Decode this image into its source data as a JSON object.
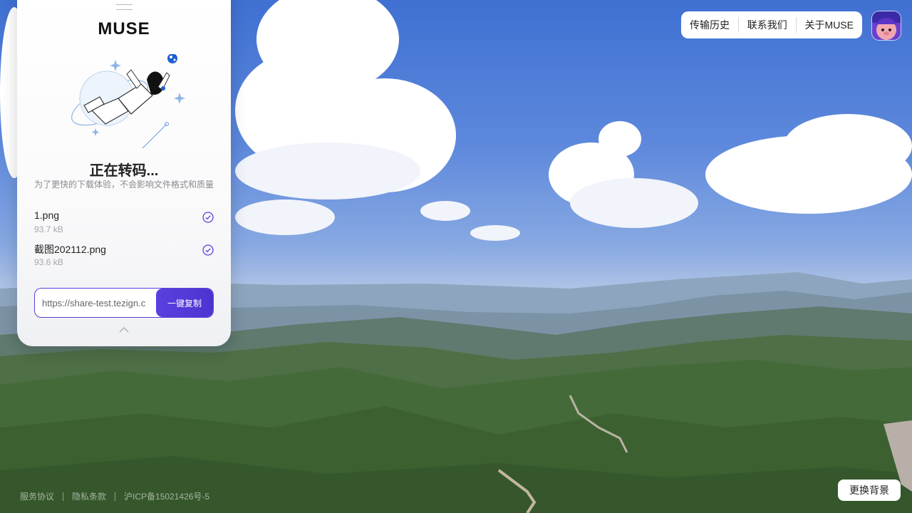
{
  "app": {
    "logo": "MUSE"
  },
  "status": {
    "title": "正在转码...",
    "subtitle": "为了更快的下载体验，不会影响文件格式和质量"
  },
  "files": [
    {
      "name": "1.png",
      "size": "93.7 kB"
    },
    {
      "name": "截图202112.png",
      "size": "93.6 kB"
    }
  ],
  "share": {
    "link": "https://share-test.tezign.c",
    "copy_label": "一键复制"
  },
  "nav": {
    "items": [
      "传输历史",
      "联系我们",
      "关于MUSE"
    ]
  },
  "footer": {
    "links": [
      "服务协议",
      "隐私条款",
      "沪ICP备15021426号-5"
    ],
    "change_bg_label": "更换背景"
  },
  "colors": {
    "accent": "#5b3fe0",
    "check": "#5b3fe0"
  }
}
